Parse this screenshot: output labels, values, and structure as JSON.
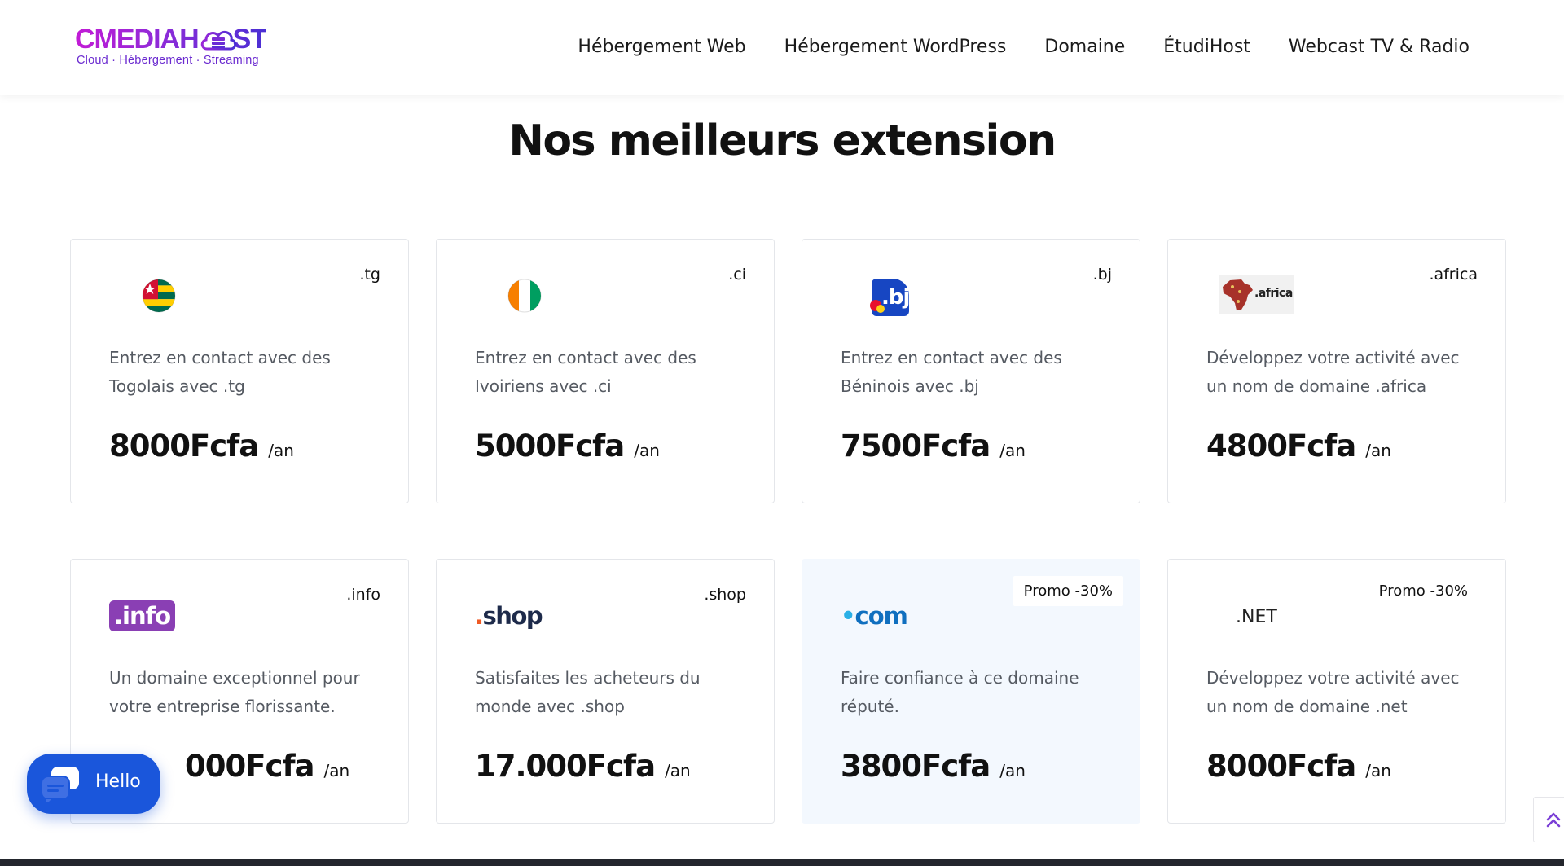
{
  "brand": {
    "name_part1": "CMEDIAH",
    "name_part2": "ST",
    "tagline": "Cloud · Hébergement · Streaming"
  },
  "nav": {
    "items": [
      {
        "label": "Hébergement Web"
      },
      {
        "label": "Hébergement WordPress"
      },
      {
        "label": "Domaine"
      },
      {
        "label": "ÉtudiHost"
      },
      {
        "label": "Webcast TV & Radio"
      }
    ]
  },
  "section": {
    "title": "Nos meilleurs extension"
  },
  "cards": [
    {
      "tag": ".tg",
      "description": "Entrez en contact avec des Togolais avec .tg",
      "price": "8000Fcfa",
      "per": "/an"
    },
    {
      "tag": ".ci",
      "description": "Entrez en contact avec des Ivoiriens avec .ci",
      "price": "5000Fcfa",
      "per": "/an"
    },
    {
      "tag": ".bj",
      "description": "Entrez en contact avec des Béninois avec .bj",
      "price": "7500Fcfa",
      "per": "/an",
      "logo_text": ".bj"
    },
    {
      "tag": ".africa",
      "description": "Développez votre activité avec un nom de domaine .africa",
      "price": "4800Fcfa",
      "per": "/an",
      "logo_text": ".africa"
    },
    {
      "tag": ".info",
      "description": "Un domaine exceptionnel pour votre entreprise florissante.",
      "price": "000Fcfa",
      "per": "/an",
      "logo_text": ".info"
    },
    {
      "tag": ".shop",
      "description": "Satisfaites les acheteurs du monde avec .shop",
      "price": "17.000Fcfa",
      "per": "/an",
      "logo_dot": ".",
      "logo_text": "shop"
    },
    {
      "promo": "Promo -30%",
      "description": "Faire confiance à ce domaine réputé.",
      "price": "3800Fcfa",
      "per": "/an",
      "logo_dot": "•",
      "logo_text": "com"
    },
    {
      "promo": "Promo -30%",
      "description": "Développez votre activité avec un nom de domaine .net",
      "price": "8000Fcfa",
      "per": "/an",
      "logo_text": ".NET"
    }
  ],
  "chat": {
    "label": "Hello",
    "icon": "chat-bubble-icon"
  },
  "scroll_top": {
    "icon": "double-chevron-up-icon"
  },
  "colors": {
    "brand_pink": "#c21bd6",
    "brand_violet": "#4a2fd4",
    "chat_blue": "#1a56db",
    "highlight_card": "#f3f8fe"
  }
}
